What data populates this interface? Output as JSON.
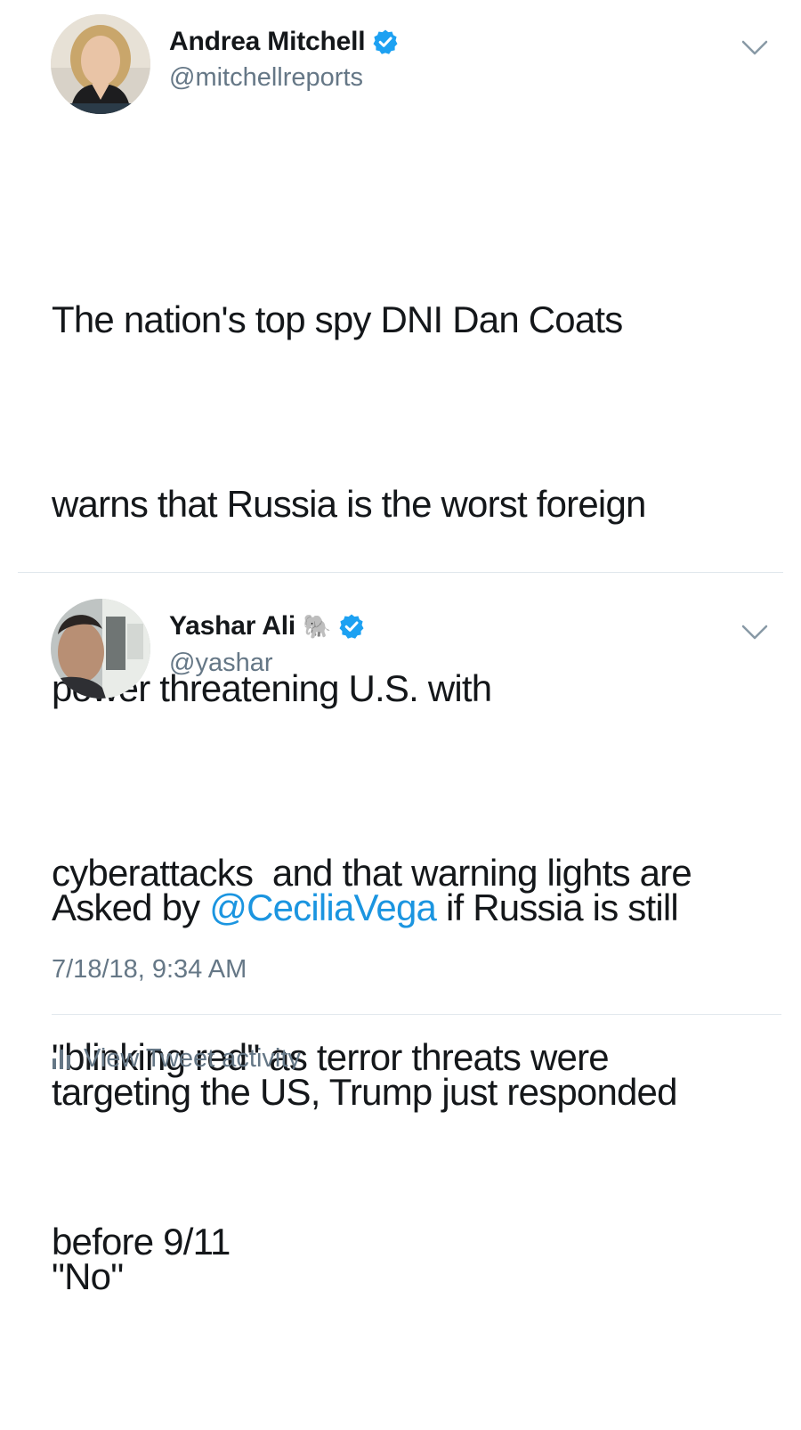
{
  "tweets": [
    {
      "display_name": "Andrea Mitchell",
      "handle": "@mitchellreports",
      "verified": true,
      "menu_icon": "chevron-down-icon",
      "text_lines": [
        "The nation's top spy DNI Dan Coats",
        "warns that Russia is the worst foreign",
        "power threatening U.S. with",
        "cyberattacks  and that warning lights are",
        "\"blinking red\" as terror threats were",
        "before 9/11"
      ]
    },
    {
      "display_name": "Yashar Ali",
      "name_emoji": "🐘",
      "handle": "@yashar",
      "verified": true,
      "menu_icon": "chevron-down-icon",
      "text_before_mention": "Asked by ",
      "mention": "@CeciliaVega",
      "text_after_mention": " if Russia is still",
      "text_lines_rest": [
        "targeting the US, Trump just responded",
        "\"No\""
      ],
      "timestamp": "7/18/18, 9:34 AM"
    }
  ],
  "footer": {
    "activity_label": "View Tweet activity",
    "activity_icon": "bar-chart-icon"
  },
  "colors": {
    "text": "#14171a",
    "secondary": "#657786",
    "link": "#1b95e0",
    "verified": "#1da1f2",
    "divider": "#e1e8ed"
  }
}
